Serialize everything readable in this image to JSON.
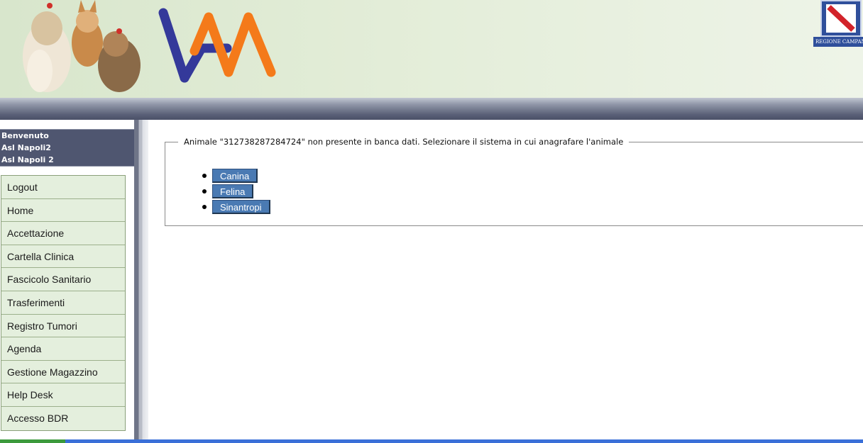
{
  "header": {
    "logo_text": "VAM",
    "region_label": "REGIONE CAMPANIA",
    "colors": {
      "logo_blue": "#3a3f9e",
      "logo_orange": "#f47a1a"
    }
  },
  "sidebar": {
    "welcome": [
      "Benvenuto",
      "Asl Napoli2",
      "Asl Napoli 2"
    ],
    "items": [
      {
        "label": "Logout"
      },
      {
        "label": "Home"
      },
      {
        "label": "Accettazione"
      },
      {
        "label": "Cartella Clinica"
      },
      {
        "label": "Fascicolo Sanitario"
      },
      {
        "label": "Trasferimenti"
      },
      {
        "label": "Registro Tumori"
      },
      {
        "label": "Agenda"
      },
      {
        "label": "Gestione Magazzino"
      },
      {
        "label": "Help Desk"
      },
      {
        "label": "Accesso BDR"
      }
    ]
  },
  "main": {
    "legend": "Animale \"312738287284724\" non presente in banca dati. Selezionare il sistema in cui anagrafare l'animale",
    "options": [
      {
        "label": "Canina"
      },
      {
        "label": "Felina"
      },
      {
        "label": "Sinantropi"
      }
    ]
  }
}
